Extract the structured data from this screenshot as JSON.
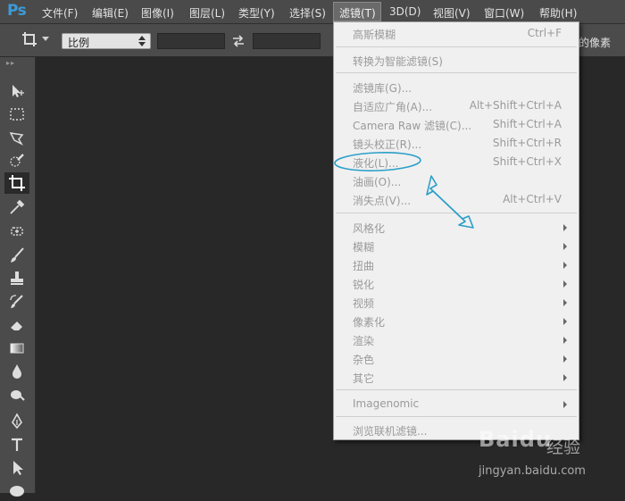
{
  "app": {
    "logo": "Ps"
  },
  "menubar": {
    "items": [
      "文件(F)",
      "编辑(E)",
      "图像(I)",
      "图层(L)",
      "类型(Y)",
      "选择(S)",
      "滤镜(T)",
      "3D(D)",
      "视图(V)",
      "窗口(W)",
      "帮助(H)"
    ]
  },
  "options_bar": {
    "ratio_select_value": "比例",
    "right_text": "的像素"
  },
  "toolbox": {
    "tools": [
      "move-tool-icon",
      "marquee-tool-icon",
      "lasso-tool-icon",
      "quick-select-tool-icon",
      "crop-tool-icon",
      "eyedropper-tool-icon",
      "healing-brush-tool-icon",
      "brush-tool-icon",
      "clone-stamp-tool-icon",
      "history-brush-tool-icon",
      "eraser-tool-icon",
      "gradient-tool-icon",
      "blur-tool-icon",
      "dodge-tool-icon",
      "pen-tool-icon",
      "type-tool-icon",
      "path-select-tool-icon",
      "shape-tool-icon"
    ]
  },
  "filter_menu": {
    "items": [
      {
        "label": "高斯模糊",
        "shortcut": "Ctrl+F",
        "enabled": false,
        "submenu": false
      },
      {
        "label": "转换为智能滤镜(S)",
        "shortcut": "",
        "enabled": false,
        "submenu": false
      },
      {
        "label": "滤镜库(G)...",
        "shortcut": "",
        "enabled": false,
        "submenu": false
      },
      {
        "label": "自适应广角(A)...",
        "shortcut": "Alt+Shift+Ctrl+A",
        "enabled": false,
        "submenu": false
      },
      {
        "label": "Camera Raw 滤镜(C)...",
        "shortcut": "Shift+Ctrl+A",
        "enabled": false,
        "submenu": false
      },
      {
        "label": "镜头校正(R)...",
        "shortcut": "Shift+Ctrl+R",
        "enabled": false,
        "submenu": false
      },
      {
        "label": "液化(L)...",
        "shortcut": "Shift+Ctrl+X",
        "enabled": false,
        "submenu": false
      },
      {
        "label": "油画(O)...",
        "shortcut": "",
        "enabled": false,
        "submenu": false
      },
      {
        "label": "消失点(V)...",
        "shortcut": "Alt+Ctrl+V",
        "enabled": false,
        "submenu": false
      },
      {
        "label": "风格化",
        "shortcut": "",
        "enabled": false,
        "submenu": true
      },
      {
        "label": "模糊",
        "shortcut": "",
        "enabled": false,
        "submenu": true
      },
      {
        "label": "扭曲",
        "shortcut": "",
        "enabled": false,
        "submenu": true
      },
      {
        "label": "锐化",
        "shortcut": "",
        "enabled": false,
        "submenu": true
      },
      {
        "label": "视频",
        "shortcut": "",
        "enabled": false,
        "submenu": true
      },
      {
        "label": "像素化",
        "shortcut": "",
        "enabled": false,
        "submenu": true
      },
      {
        "label": "渲染",
        "shortcut": "",
        "enabled": false,
        "submenu": true
      },
      {
        "label": "杂色",
        "shortcut": "",
        "enabled": false,
        "submenu": true
      },
      {
        "label": "其它",
        "shortcut": "",
        "enabled": false,
        "submenu": true
      },
      {
        "label": "Imagenomic",
        "shortcut": "",
        "enabled": false,
        "submenu": true
      },
      {
        "label": "浏览联机滤镜...",
        "shortcut": "",
        "enabled": false,
        "submenu": false
      }
    ]
  },
  "annotation": {
    "color": "#2a9fc9"
  },
  "watermark": {
    "brand": "Baidu",
    "sub": "经验",
    "url": "jingyan.baidu.com"
  }
}
